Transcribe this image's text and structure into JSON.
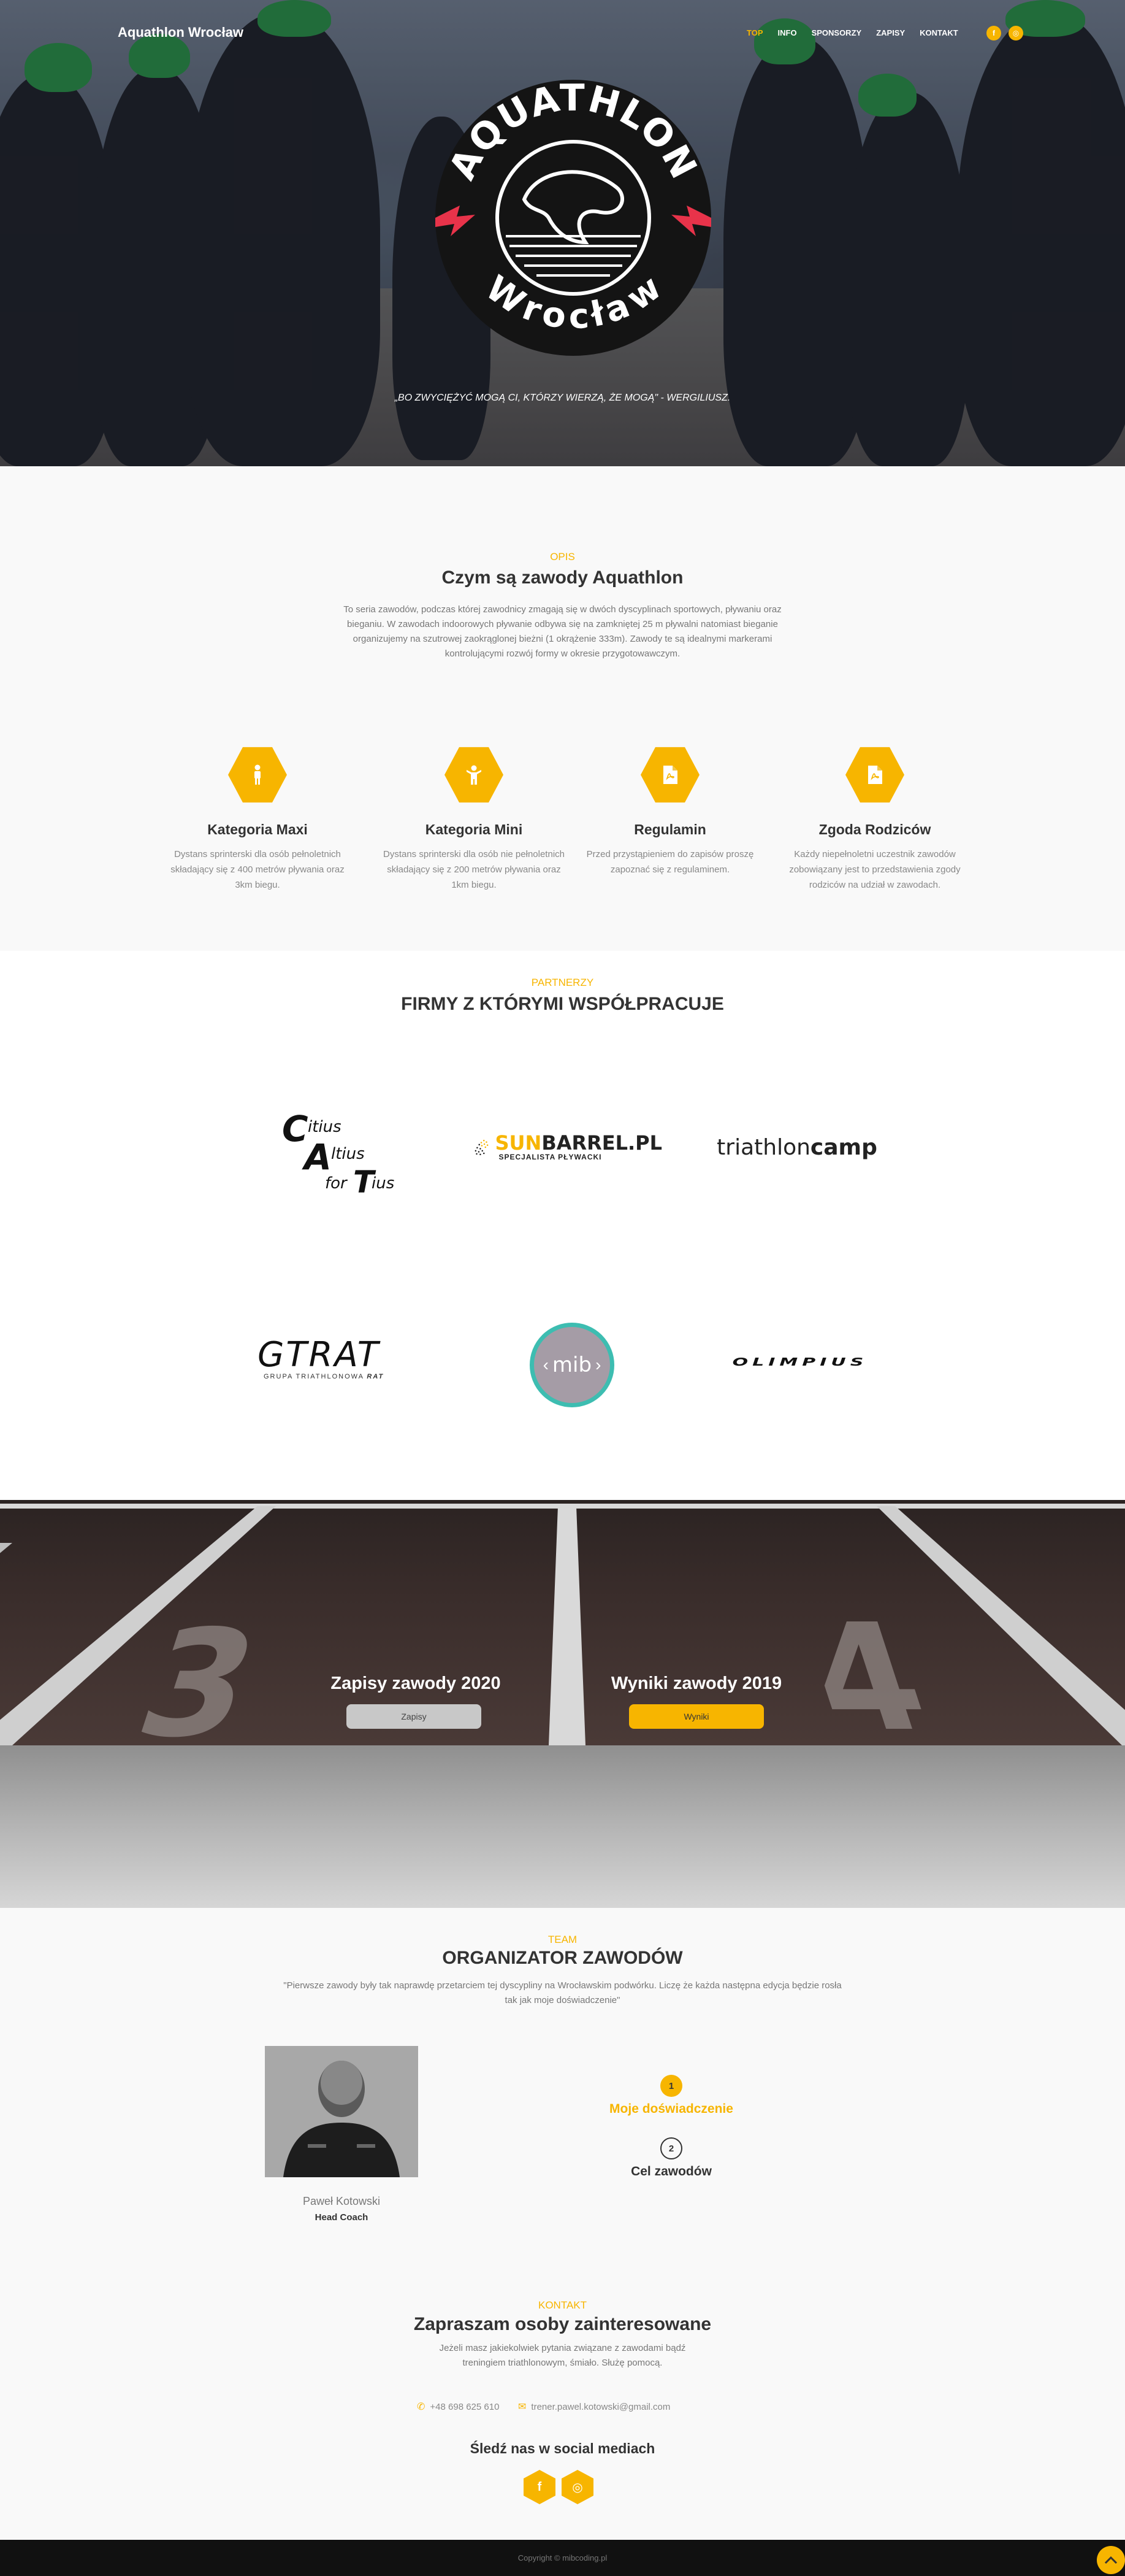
{
  "header": {
    "brand": "Aquathlon Wrocław",
    "nav": [
      {
        "label": "TOP",
        "active": true
      },
      {
        "label": "INFO",
        "active": false
      },
      {
        "label": "SPONSORZY",
        "active": false
      },
      {
        "label": "ZAPISY",
        "active": false
      },
      {
        "label": "KONTAKT",
        "active": false
      }
    ],
    "social": [
      {
        "icon": "facebook-icon",
        "glyph": "f"
      },
      {
        "icon": "instagram-icon",
        "glyph": "◎"
      }
    ]
  },
  "hero": {
    "logo_top": "AQUATHLON",
    "logo_bottom": "Wrocław",
    "quote": "„BO ZWYCIĘŻYĆ MOGĄ CI, KTÓRZY WIERZĄ, ŻE MOGĄ\" - WERGILIUSZ."
  },
  "about": {
    "eyebrow": "OPIS",
    "title": "Czym są zawody Aquathlon",
    "text": "To seria zawodów, podczas której zawodnicy zmagają się w dwóch dyscyplinach sportowych, pływaniu oraz bieganiu. W zawodach indoorowych pływanie odbywa się na zamkniętej 25 m pływalni natomiast bieganie organizujemy na szutrowej zaokrąglonej bieżni (1 okrążenie 333m). Zawody te są idealnymi markerami kontrolującymi rozwój formy w okresie przygotowawczym.",
    "features": [
      {
        "icon": "person-icon",
        "title": "Kategoria Maxi",
        "text": "Dystans sprinterski dla osób pełnoletnich składający się z 400 metrów pływania oraz 3km biegu."
      },
      {
        "icon": "child-icon",
        "title": "Kategoria Mini",
        "text": "Dystans sprinterski dla osób nie pełnoletnich składający się z 200 metrów pływania oraz 1km biegu."
      },
      {
        "icon": "pdf-file-icon",
        "title": "Regulamin",
        "text": "Przed przystąpieniem do zapisów proszę zapoznać się z regulaminem."
      },
      {
        "icon": "pdf-file-icon",
        "title": "Zgoda Rodziców",
        "text": "Każdy niepełnoletni uczestnik zawodów zobowiązany jest to przedstawienia zgody rodziców na udział w zawodach."
      }
    ]
  },
  "partners": {
    "eyebrow": "PARTNERZY",
    "title": "FIRMY Z KTÓRYMI WSPÓŁPRACUJE",
    "logos": {
      "cat": [
        "C",
        "itius",
        "A",
        "ltius",
        "for",
        "T",
        "ius"
      ],
      "sunbarrel": {
        "sun": "SUN",
        "barrel": "BARREL.PL",
        "tagline": "SPECJALISTA PŁYWACKI"
      },
      "triathloncamp": {
        "a": "triathlon",
        "b": "camp"
      },
      "gtrat": {
        "name": "GTRAT",
        "tagline_a": "GRUPA TRIATHLONOWA",
        "tagline_b": "RAT"
      },
      "mib": "mib",
      "olimpius": "OLIMPIUS"
    }
  },
  "cta": {
    "signup_title": "Zapisy zawody 2020",
    "signup_button": "Zapisy",
    "results_title": "Wyniki zawody 2019",
    "results_button": "Wyniki",
    "track_numbers": [
      "3",
      "4"
    ]
  },
  "team": {
    "eyebrow": "TEAM",
    "title": "ORGANIZATOR ZAWODÓW",
    "quote": "\"Pierwsze zawody były tak naprawdę przetarciem tej dyscypliny na Wrocławskim podwórku. Liczę że każda następna edycja będzie rosła tak jak moje doświadczenie\"",
    "coach_name": "Paweł Kotowski",
    "coach_role": "Head Coach",
    "steps": [
      {
        "num": "1",
        "label": "Moje doświadczenie",
        "active": true
      },
      {
        "num": "2",
        "label": "Cel zawodów",
        "active": false
      }
    ]
  },
  "contact": {
    "eyebrow": "KONTAKT",
    "title": "Zapraszam osoby zainteresowane",
    "text": "Jeżeli masz jakiekolwiek pytania związane z zawodami bądź treningiem triathlonowym, śmiało. Służę pomocą.",
    "phone": "+48 698 625 610",
    "email": "trener.pawel.kotowski@gmail.com",
    "social_title": "Śledź nas w social mediach"
  },
  "footer": {
    "copyright": "Copyright © mibcoding.pl"
  },
  "colors": {
    "accent": "#f7b500",
    "dark": "#333333",
    "footer": "#111111"
  }
}
